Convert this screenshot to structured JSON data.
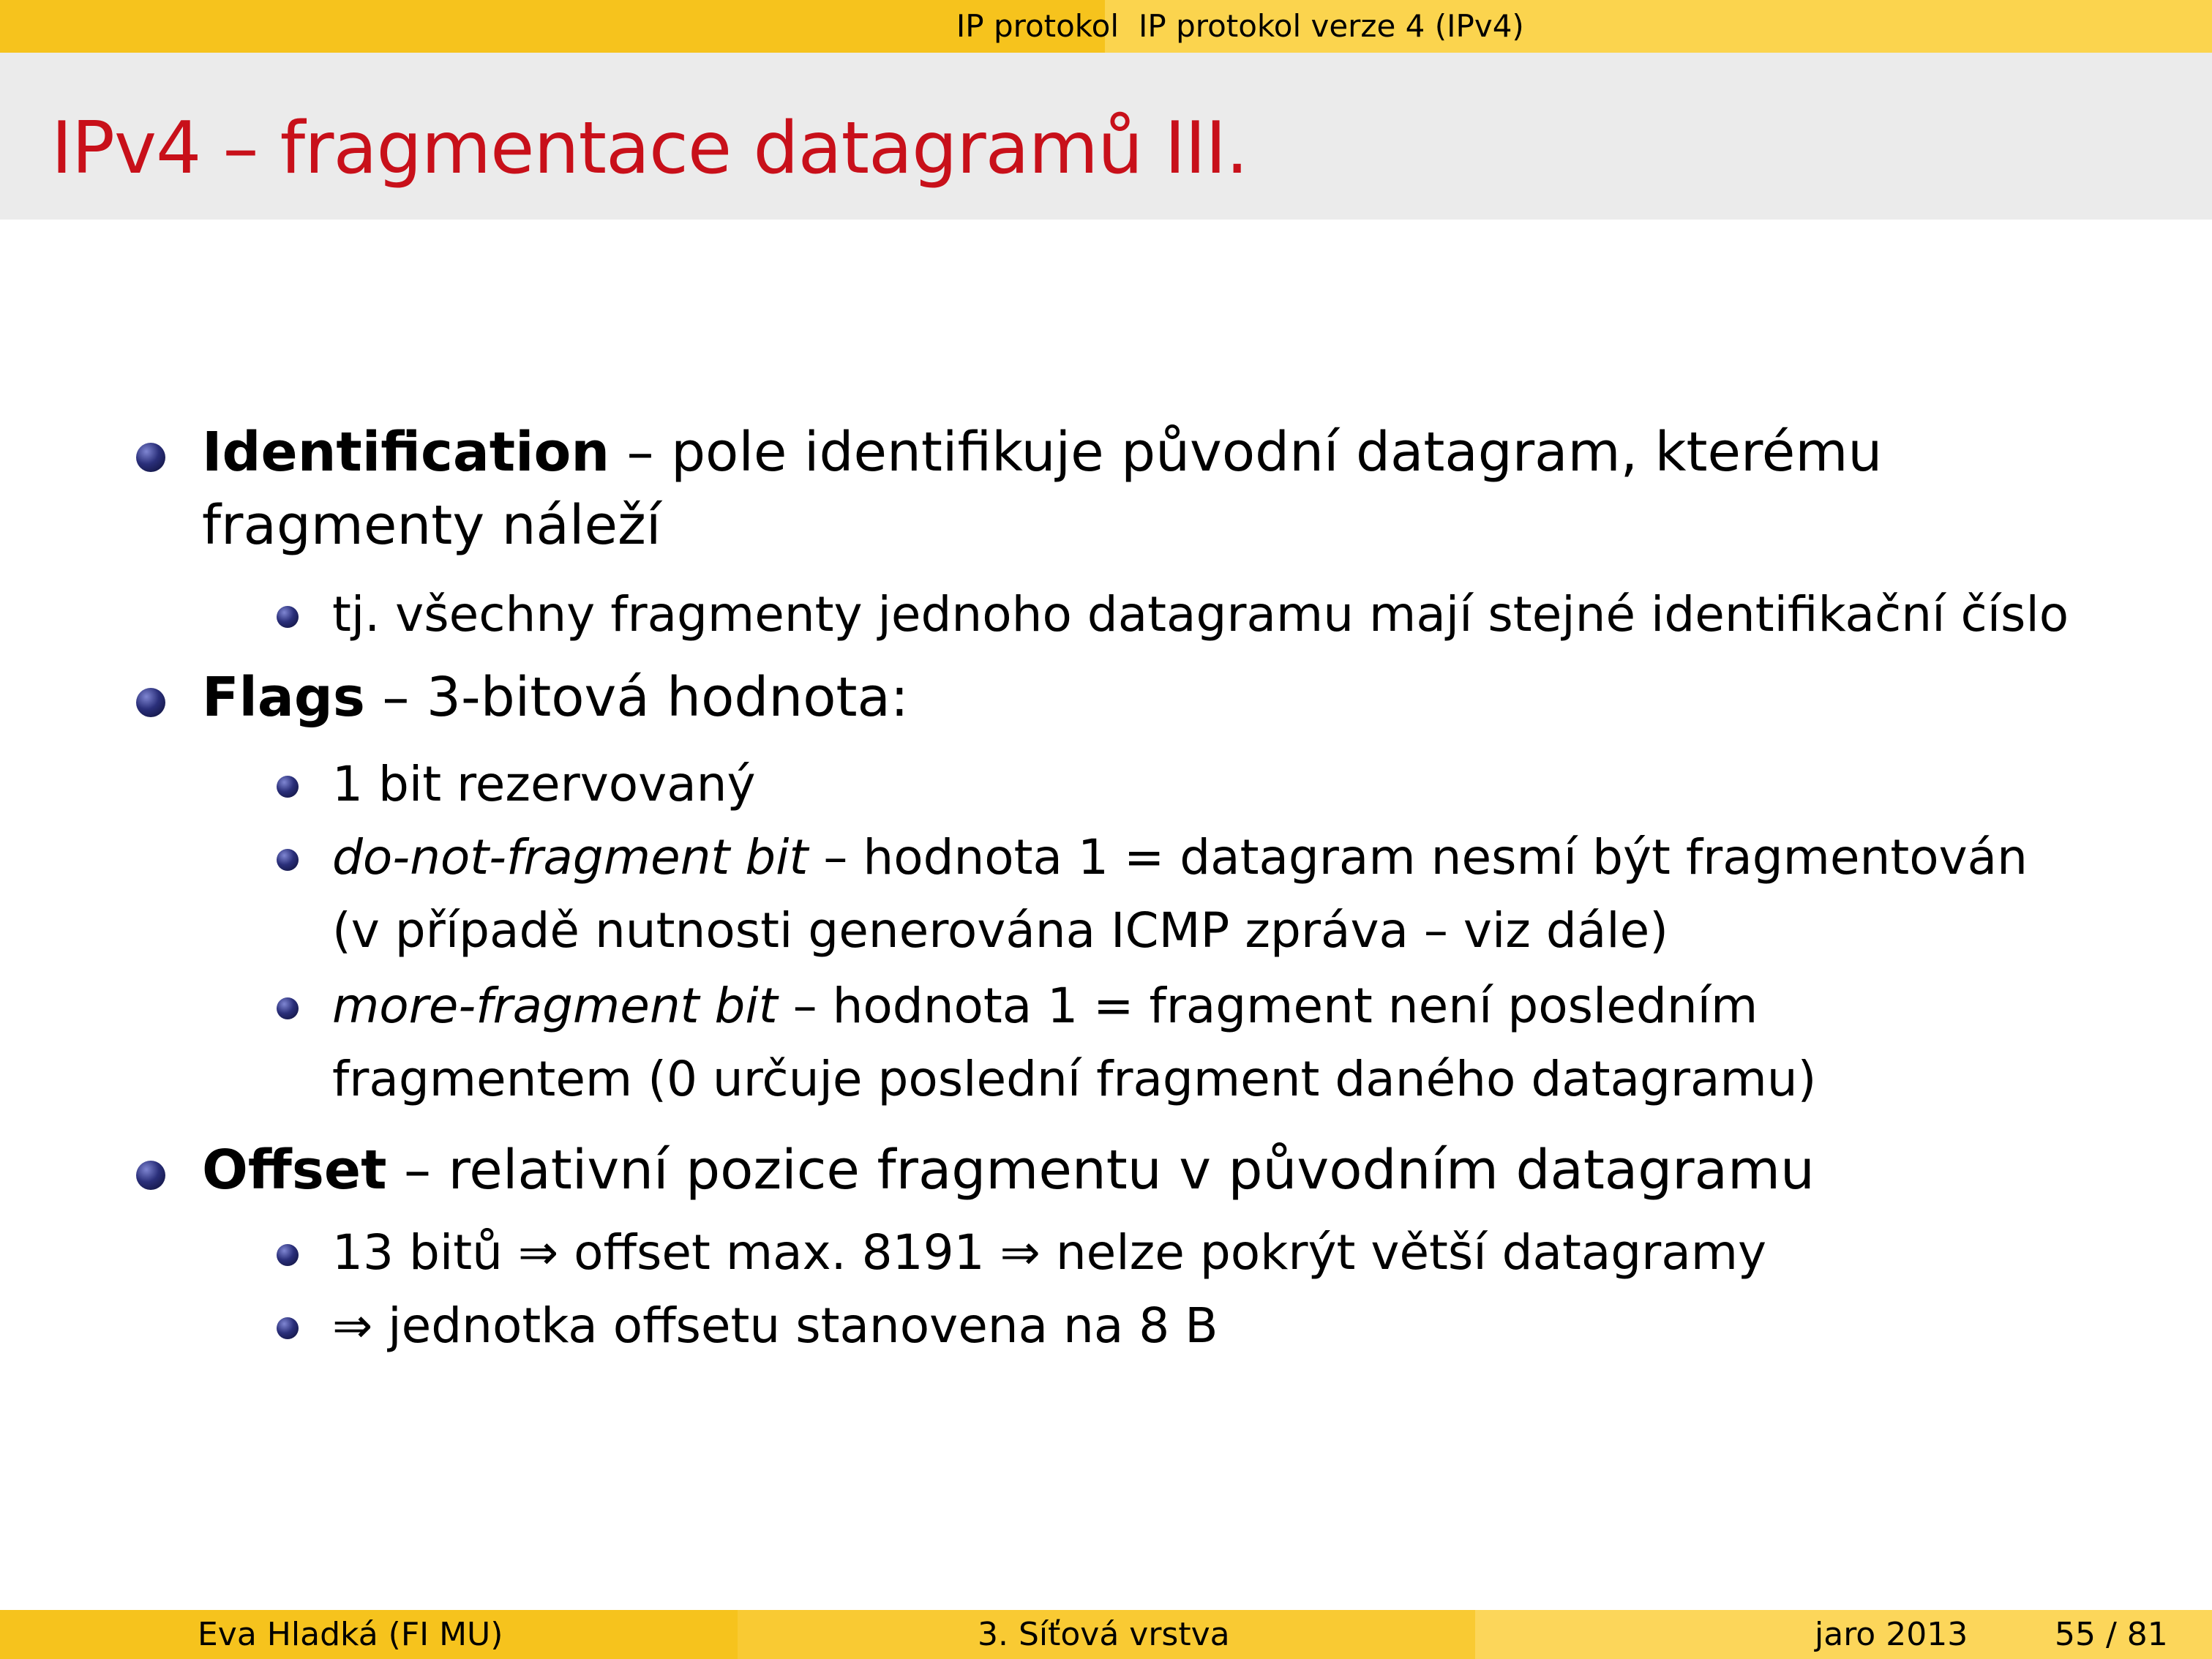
{
  "nav": {
    "section": "IP protokol",
    "subsection": "IP protokol verze 4 (IPv4)"
  },
  "slide": {
    "title": "IPv4 – fragmentace datagramů III."
  },
  "content": {
    "identification": {
      "term": "Identification",
      "text_line1": " – pole identifikuje původní datagram, kterému",
      "text_line2": "fragmenty náleží",
      "sub1": "tj. všechny fragmenty jednoho datagramu mají stejné identifikační číslo"
    },
    "flags": {
      "term": "Flags",
      "text": " – 3-bitová hodnota:",
      "sub1": "1 bit rezervovaný",
      "sub2_term": "do-not-fragment bit",
      "sub2_line1": " – hodnota 1 = datagram nesmí být fragmentován",
      "sub2_line2": "(v případě nutnosti generována ICMP zpráva – viz dále)",
      "sub3_term": "more-fragment bit",
      "sub3_line1": " – hodnota 1 = fragment není posledním",
      "sub3_line2": "fragmentem (0 určuje poslední fragment daného datagramu)"
    },
    "offset": {
      "term": "Offset",
      "text": " – relativní pozice fragmentu v původním datagramu",
      "sub1": "13 bitů ⇒ offset max. 8191 ⇒ nelze pokrýt větší datagramy",
      "sub2": "⇒ jednotka offsetu stanovena na 8 B"
    }
  },
  "footer": {
    "author": "Eva Hladká  (FI MU)",
    "lecture": "3. Síťová vrstva",
    "date": "jaro 2013",
    "page": "55 / 81"
  },
  "colors": {
    "title_red": "#c8101a",
    "bar_gold": "#f6c31d",
    "bar_light": "#fbd44e",
    "title_band": "#ebebeb",
    "bullet_blue": "#2a2f7a"
  }
}
